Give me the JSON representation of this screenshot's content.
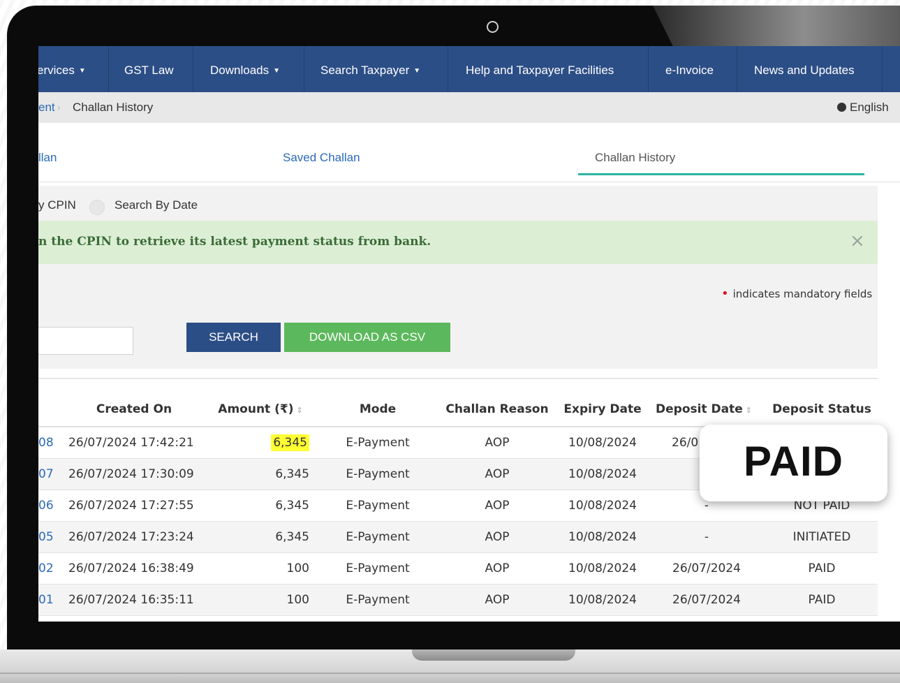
{
  "nav": {
    "items": [
      {
        "label": "ervices",
        "dropdown": true
      },
      {
        "label": "GST Law",
        "dropdown": false
      },
      {
        "label": "Downloads",
        "dropdown": true
      },
      {
        "label": "Search Taxpayer",
        "dropdown": true
      },
      {
        "label": "Help and Taxpayer Facilities",
        "dropdown": false
      },
      {
        "label": "e-Invoice",
        "dropdown": false
      },
      {
        "label": "News and Updates",
        "dropdown": false
      }
    ]
  },
  "breadcrumb": {
    "parent": "ent",
    "current": "Challan History",
    "language": "English"
  },
  "tabs": [
    "llan",
    "Saved Challan",
    "Challan History"
  ],
  "search": {
    "radio_cpin": "y CPIN",
    "radio_date": "Search By Date",
    "alert": "n the CPIN to retrieve its latest payment status from bank.",
    "close": "×",
    "mandatory_note": "indicates mandatory fields",
    "search_button": "SEARCH",
    "csv_button": "DOWNLOAD AS CSV"
  },
  "table": {
    "headers": [
      "Created On",
      "Amount (₹)",
      "Mode",
      "Challan Reason",
      "Expiry Date",
      "Deposit Date",
      "Deposit Status"
    ],
    "rows": [
      {
        "cpin": "08",
        "created": "26/07/2024 17:42:21",
        "amount": "6,345",
        "mode": "E-Payment",
        "reason": "AOP",
        "expiry": "10/08/2024",
        "deposit_date": "26/0",
        "status": ""
      },
      {
        "cpin": "07",
        "created": "26/07/2024 17:30:09",
        "amount": "6,345",
        "mode": "E-Payment",
        "reason": "AOP",
        "expiry": "10/08/2024",
        "deposit_date": "",
        "status": ""
      },
      {
        "cpin": "06",
        "created": "26/07/2024 17:27:55",
        "amount": "6,345",
        "mode": "E-Payment",
        "reason": "AOP",
        "expiry": "10/08/2024",
        "deposit_date": "-",
        "status": "NOT PAID"
      },
      {
        "cpin": "05",
        "created": "26/07/2024 17:23:24",
        "amount": "6,345",
        "mode": "E-Payment",
        "reason": "AOP",
        "expiry": "10/08/2024",
        "deposit_date": "-",
        "status": "INITIATED"
      },
      {
        "cpin": "02",
        "created": "26/07/2024 16:38:49",
        "amount": "100",
        "mode": "E-Payment",
        "reason": "AOP",
        "expiry": "10/08/2024",
        "deposit_date": "26/07/2024",
        "status": "PAID"
      },
      {
        "cpin": "01",
        "created": "26/07/2024 16:35:11",
        "amount": "100",
        "mode": "E-Payment",
        "reason": "AOP",
        "expiry": "10/08/2024",
        "deposit_date": "26/07/2024",
        "status": "PAID"
      }
    ]
  },
  "callout": {
    "text": "PAID"
  },
  "colors": {
    "nav": "#2c4e86",
    "search_button": "#2c4e86",
    "csv_button": "#5cb85c",
    "alert_bg": "#dcefd5",
    "tab_underline": "#2bb3a0",
    "highlight": "#ffff33"
  }
}
